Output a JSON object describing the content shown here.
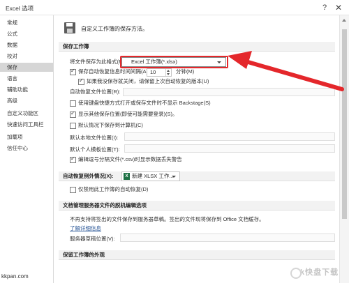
{
  "window": {
    "title": "Excel 选项",
    "help": "?",
    "close": "✕"
  },
  "sidebar": {
    "items": [
      {
        "label": "常规"
      },
      {
        "label": "公式"
      },
      {
        "label": "数据"
      },
      {
        "label": "校对"
      },
      {
        "label": "保存",
        "active": true
      },
      {
        "label": "语言"
      },
      {
        "label": "辅助功能"
      },
      {
        "label": "高级"
      },
      {
        "label": "自定义功能区"
      },
      {
        "label": "快速访问工具栏"
      },
      {
        "label": "加载项"
      },
      {
        "label": "信任中心"
      }
    ]
  },
  "header": {
    "text": "自定义工作簿的保存方法。"
  },
  "save_workbooks": {
    "title": "保存工作簿",
    "format_label": "将文件保存为此格式(F):",
    "format_value": "Excel 工作簿(*.xlsx)",
    "autorecover_label": "保存自动恢复信息时间间隔(A)",
    "autorecover_minutes": "10",
    "minutes_label": "分钟(M)",
    "keep_last_label": "如果我没保存就关闭，请保留上次自动恢复的版本(U)",
    "autorecover_location_label": "自动恢复文件位置(R):",
    "no_backstage_label": "使用键盘快捷方式打开或保存文件时不显示 Backstage(S)",
    "show_more_places_label": "显示其他保存位置(即使可能需要登录)(S)。",
    "save_to_computer_label": "默认情况下保存到计算机(C)",
    "default_local_label": "默认本地文件位置(I):",
    "default_personal_label": "默认个人模板位置(T):",
    "csv_warning_label": "编辑逗号分隔文件(*.csv)时显示数据丢失警告"
  },
  "autorecover_exceptions": {
    "title_label": "自动恢复例外情况(X):",
    "workbook_value": "新建 XLSX 工作...",
    "disable_label": "仅禁用此工作簿的自动恢复(D)"
  },
  "offline_editing": {
    "title": "文档管理服务器文件的脱机编辑选项",
    "desc": "不再支持将签出的文件保存到服务器草稿。签出的文件现将保存到 Office 文档缓存。",
    "learn_more": "了解详细信息",
    "server_drafts_label": "服务器草稿位置(V):"
  },
  "preserve_visual": {
    "title": "保留工作簿的外观"
  },
  "xl_icon_letter": "X",
  "watermark": "kkpan.com",
  "watermark_logo": "k快盘下载",
  "colors": {
    "arrow": "#e4272b",
    "excel_green": "#1d7044"
  }
}
